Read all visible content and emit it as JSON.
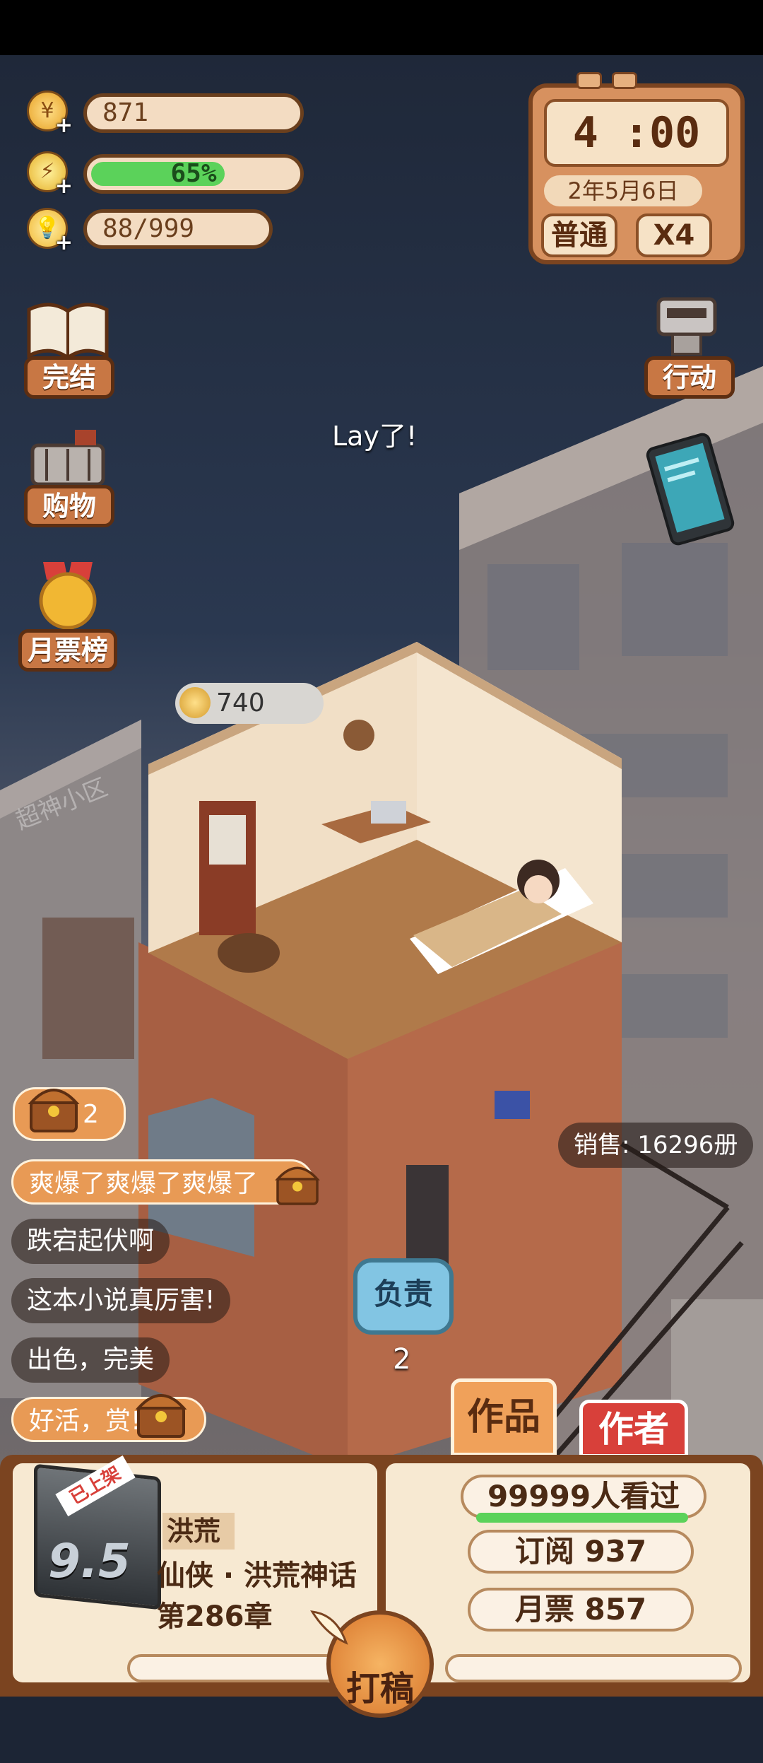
{
  "resources": {
    "coins": "871",
    "energy_percent": "65%",
    "energy_level": 0.65,
    "ideas": "88/999"
  },
  "clock": {
    "time": "4 :00",
    "date": "2年5月6日",
    "mode": "普通",
    "speed": "X4"
  },
  "left_menu": {
    "finish": "完结",
    "shopping": "购物",
    "monthly_ticket_rank": "月票榜"
  },
  "right_menu": {
    "action": "行动"
  },
  "scene": {
    "floating_text": "Lay了!",
    "room_coin_bubble": "740",
    "building_sign": "超神小区",
    "sales": "销售: 16296册",
    "responsible_label": "负责",
    "responsible_count": "2"
  },
  "comments": {
    "chest_count": "2",
    "items": [
      "爽爆了爽爆了爽爆了",
      "跌宕起伏啊",
      "这本小说真厉害!",
      "出色，完美",
      "好活，赏!"
    ]
  },
  "tabs": {
    "works": "作品",
    "author": "作者"
  },
  "book": {
    "shelf_tag": "已上架",
    "rating": "9.5",
    "title": "洪荒",
    "genre": "仙侠 · 洪荒神话",
    "chapter": "第286章",
    "views": "99999人看过",
    "subscriptions": "订阅 937",
    "monthly_tickets": "月票 857",
    "write_button": "打稿"
  },
  "colors": {
    "brown_border": "#6a3f1d",
    "energy_green": "#5bd25a",
    "author_tab_red": "#d8403a",
    "works_tab_orange": "#f0a15a"
  }
}
